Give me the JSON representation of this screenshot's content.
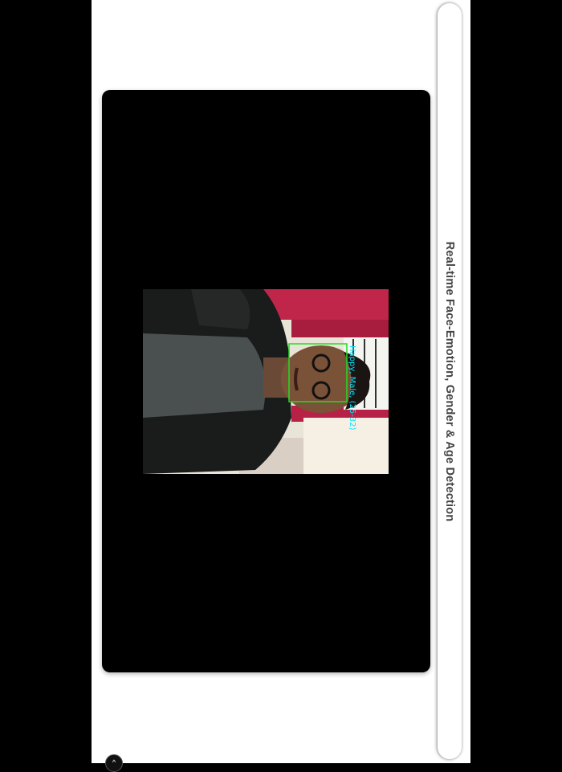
{
  "app": {
    "title": "Real-time Face-Emotion, Gender & Age Detection"
  },
  "video": {
    "detection_label": "Happy, Male, (25-32)",
    "box_color": "#22dd22",
    "label_color": "#00e5ff"
  },
  "floating_button": {
    "icon": "chevron-up-icon",
    "glyph": "^"
  }
}
